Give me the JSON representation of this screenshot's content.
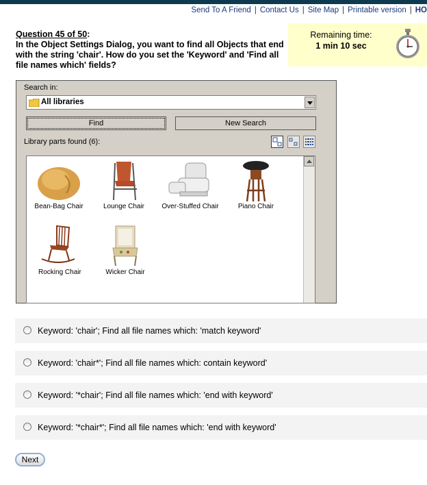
{
  "top_links": {
    "send_to_friend": "Send To A Friend",
    "contact_us": "Contact Us",
    "site_map": "Site Map",
    "printable": "Printable version",
    "home": "HO"
  },
  "question": {
    "number": "Question 45 of 50",
    "colon": ":",
    "text": "In the Object Settings Dialog, you want to find all Objects that end with the string 'chair'. How do you set the 'Keyword' and 'Find all file names which' fields?"
  },
  "timer": {
    "label": "Remaining time:",
    "value": "1 min 10 sec",
    "icon": "stopwatch-icon"
  },
  "dialog": {
    "search_in_label": "Search in:",
    "search_in_value": "All libraries",
    "find_label": "Find",
    "new_search_label": "New Search",
    "found_label": "Library parts found (6):",
    "items": [
      {
        "name": "Bean-Bag Chair",
        "icon": "bean-bag-chair-icon"
      },
      {
        "name": "Lounge Chair",
        "icon": "lounge-chair-icon"
      },
      {
        "name": "Over-Stuffed Chair",
        "icon": "over-stuffed-chair-icon"
      },
      {
        "name": "Piano Chair",
        "icon": "piano-chair-icon"
      },
      {
        "name": "Rocking Chair",
        "icon": "rocking-chair-icon"
      },
      {
        "name": "Wicker Chair",
        "icon": "wicker-chair-icon"
      }
    ]
  },
  "options": [
    "Keyword: 'chair'; Find all file names which: 'match keyword'",
    "Keyword: 'chair*'; Find all file names which: contain keyword'",
    "Keyword: '*chair'; Find all file names which: 'end with keyword'",
    "Keyword: '*chair*'; Find all file names which: 'end with keyword'"
  ],
  "next_label": "Next",
  "colors": {
    "top_bar": "#0e3a4f",
    "link": "#1a3a7a",
    "timer_bg": "#ffffcc",
    "dialog_bg": "#d4d0c8",
    "option_bg": "#f3f3f3"
  }
}
